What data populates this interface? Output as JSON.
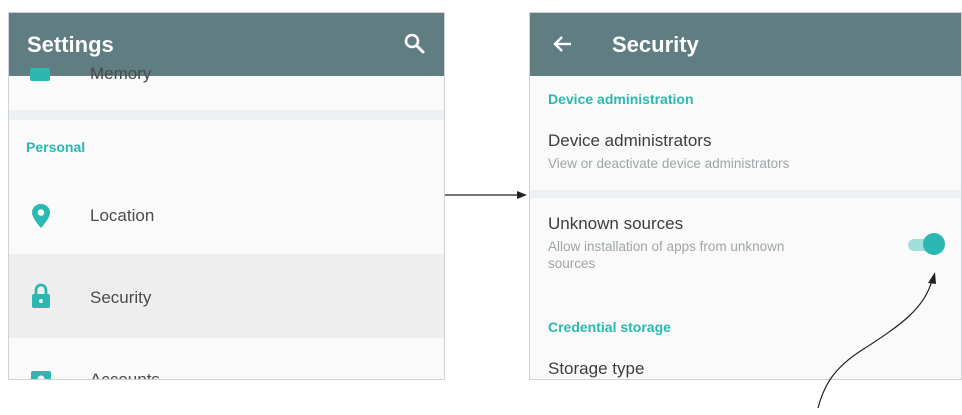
{
  "left_screen": {
    "title": "Settings",
    "search_icon": "search-icon",
    "partial_top_item": "Memory",
    "section": "Personal",
    "items": [
      {
        "label": "Location",
        "icon": "location-pin-icon"
      },
      {
        "label": "Security",
        "icon": "lock-icon"
      },
      {
        "label": "Accounts",
        "icon": "account-icon"
      }
    ]
  },
  "right_screen": {
    "title": "Security",
    "back_icon": "back-arrow-icon",
    "sections": {
      "device_admin": "Device administration",
      "credential_storage": "Credential storage"
    },
    "device_administrators": {
      "title": "Device administrators",
      "subtitle": "View or deactivate device administrators"
    },
    "unknown_sources": {
      "title": "Unknown sources",
      "subtitle_line1": "Allow installation of apps from unknown",
      "subtitle_line2": "sources",
      "toggle_on": true
    },
    "storage_type": {
      "title": "Storage type"
    }
  },
  "colors": {
    "appbar": "#607d81",
    "accent": "#2bb8b1",
    "selected_row": "#eeeeee"
  }
}
